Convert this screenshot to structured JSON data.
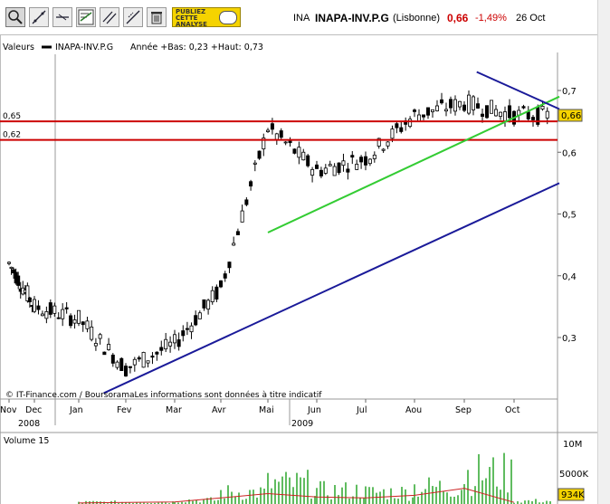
{
  "toolbar": {
    "tools": [
      {
        "name": "zoom-icon"
      },
      {
        "name": "draw-line-icon"
      },
      {
        "name": "draw-segment-icon"
      },
      {
        "name": "horizontal-line-icon"
      },
      {
        "name": "indicator-icon"
      },
      {
        "name": "parallel-lines-icon"
      },
      {
        "name": "fibonacci-icon"
      },
      {
        "name": "trash-icon"
      }
    ],
    "publish": [
      "PUBLIEZ",
      "CETTE",
      "ANALYSE"
    ]
  },
  "header": {
    "market_code": "INA",
    "symbol": "INAPA-INV.P.G",
    "exchange": "(Lisbonne)",
    "price": "0,66",
    "change": "-1,49%",
    "date": "26 Oct"
  },
  "legend": {
    "label": "Valeurs",
    "series": "INAPA-INV.P.G",
    "range_text": "Année +Bas: 0,23 +Haut: 0,73"
  },
  "credit": "© IT-Finance.com / BoursoramaLes informations sont données à titre indicatif",
  "price_badge": "0,66",
  "volume": {
    "label": "Volume 15",
    "badge": "934K",
    "ticks": [
      "10M",
      "5000K"
    ]
  },
  "colors": {
    "candles": "#000000",
    "support_red": "#cc0000",
    "trend_green": "#33cc33",
    "trend_blue": "#1a1a99",
    "volume_bars": "#2aa52a",
    "volume_ma": "#cc2222",
    "badge": "#f5d300"
  },
  "chart_data": [
    {
      "type": "candlestick",
      "title": "INAPA-INV.P.G",
      "ylim": [
        0.2,
        0.75
      ],
      "y_ticks": [
        "0,3",
        "0,4",
        "0,5",
        "0,6",
        "0,7"
      ],
      "x_ticks": [
        "Nov",
        "Dec",
        "Jan",
        "Fev",
        "Mar",
        "Avr",
        "Mai",
        "Jun",
        "Jul",
        "Aou",
        "Sep",
        "Oct"
      ],
      "year_labels": [
        "2008",
        "2009"
      ],
      "grid": false,
      "series": [
        {
          "name": "INAPA-INV.P.G",
          "x": [
            "Nov",
            "Dec",
            "Jan",
            "Fev",
            "Mar",
            "Avr",
            "Mai",
            "Jun",
            "Jul",
            "Aou",
            "Sep",
            "Oct"
          ],
          "values": [
            0.42,
            0.35,
            0.33,
            0.25,
            0.29,
            0.38,
            0.64,
            0.57,
            0.59,
            0.66,
            0.68,
            0.66
          ]
        }
      ],
      "horizontal_lines": [
        {
          "label": "0,65",
          "value": 0.65
        },
        {
          "label": "0,62",
          "value": 0.62
        }
      ],
      "trendlines": [
        {
          "color": "green",
          "from": [
            "Mai",
            0.47
          ],
          "to": [
            "Oct",
            0.69
          ]
        },
        {
          "color": "blue",
          "from": [
            "Fev",
            0.21
          ],
          "to": [
            "Oct",
            0.55
          ]
        },
        {
          "color": "blue",
          "from": [
            "Sep",
            0.73
          ],
          "to": [
            "Oct",
            0.67
          ]
        }
      ]
    },
    {
      "type": "bar",
      "title": "Volume 15",
      "ylim": [
        0,
        12000000
      ],
      "y_ticks": [
        "5000K",
        "10M"
      ],
      "series": [
        {
          "name": "Volume 15",
          "x": [
            "Jan",
            "Mar",
            "Avr",
            "Mai",
            "Jun",
            "Jul",
            "Aou",
            "Sep",
            "Oct"
          ],
          "values": [
            600000,
            1200000,
            3500000,
            6000000,
            4000000,
            3500000,
            5000000,
            9000000,
            934000
          ]
        }
      ]
    }
  ]
}
